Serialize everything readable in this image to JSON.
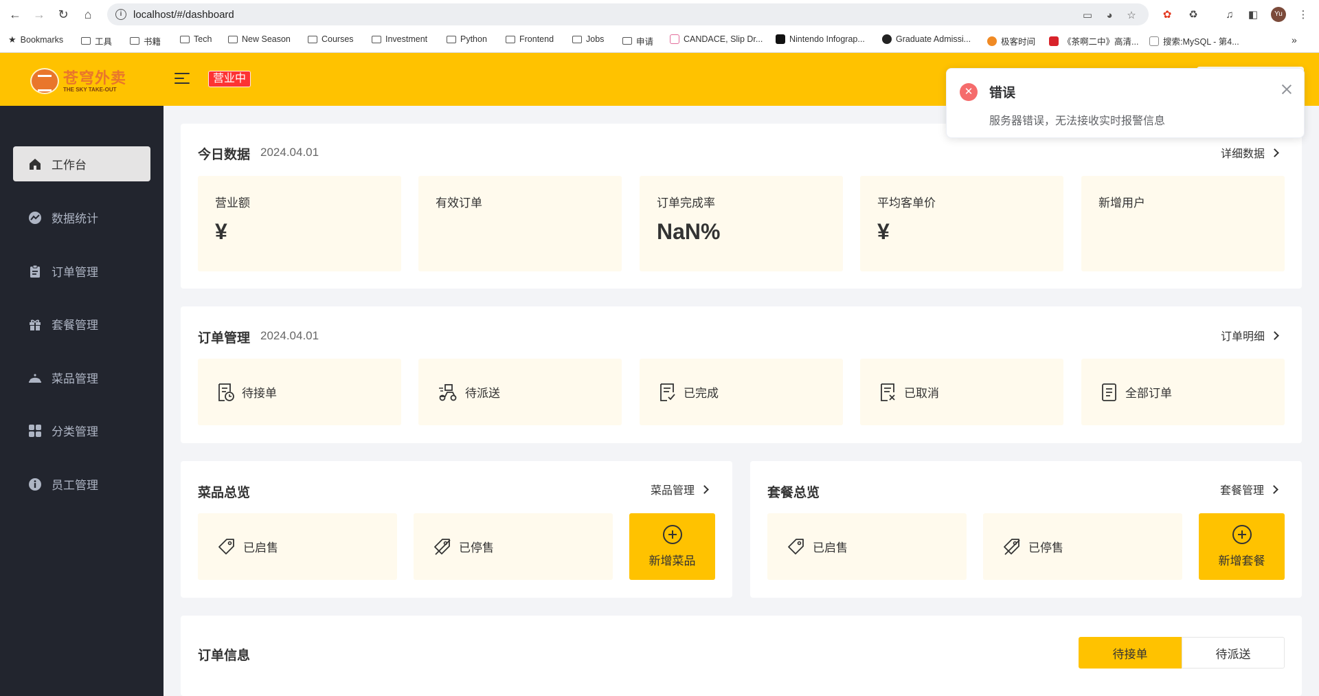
{
  "browser": {
    "url": "localhost/#/dashboard",
    "avatar": "Yu",
    "bookmarks": [
      {
        "label": "Bookmarks",
        "type": "star"
      },
      {
        "label": "工具",
        "type": "folder"
      },
      {
        "label": "书籍",
        "type": "folder"
      },
      {
        "label": "Tech",
        "type": "folder"
      },
      {
        "label": "New Season",
        "type": "folder"
      },
      {
        "label": "Courses",
        "type": "folder"
      },
      {
        "label": "Investment",
        "type": "folder"
      },
      {
        "label": "Python",
        "type": "folder"
      },
      {
        "label": "Frontend",
        "type": "folder"
      },
      {
        "label": "Jobs",
        "type": "folder"
      },
      {
        "label": "申请",
        "type": "folder"
      },
      {
        "label": "CANDACE, Slip Dr...",
        "type": "site"
      },
      {
        "label": "Nintendo Infograp...",
        "type": "site"
      },
      {
        "label": "Graduate Admissi...",
        "type": "site"
      },
      {
        "label": "极客时间",
        "type": "site"
      },
      {
        "label": "《茶啊二中》高清...",
        "type": "site"
      },
      {
        "label": "搜索:MySQL - 第4...",
        "type": "site"
      }
    ]
  },
  "header": {
    "logo_cn": "苍穹外卖",
    "logo_en": "THE SKY TAKE-OUT",
    "status": "营业中",
    "brand_color": "#ffc200"
  },
  "sidebar": {
    "items": [
      {
        "label": "工作台",
        "icon": "home-icon",
        "active": true
      },
      {
        "label": "数据统计",
        "icon": "chart-icon",
        "active": false
      },
      {
        "label": "订单管理",
        "icon": "clipboard-icon",
        "active": false
      },
      {
        "label": "套餐管理",
        "icon": "gift-icon",
        "active": false
      },
      {
        "label": "菜品管理",
        "icon": "dish-cover-icon",
        "active": false
      },
      {
        "label": "分类管理",
        "icon": "grid-icon",
        "active": false
      },
      {
        "label": "员工管理",
        "icon": "info-icon",
        "active": false
      }
    ]
  },
  "today": {
    "title": "今日数据",
    "date": "2024.04.01",
    "link": "详细数据",
    "stats": [
      {
        "label": "营业额",
        "value": "¥"
      },
      {
        "label": "有效订单",
        "value": ""
      },
      {
        "label": "订单完成率",
        "value": "NaN%"
      },
      {
        "label": "平均客单价",
        "value": "¥"
      },
      {
        "label": "新增用户",
        "value": ""
      }
    ]
  },
  "orders": {
    "title": "订单管理",
    "date": "2024.04.01",
    "link": "订单明细",
    "items": [
      {
        "label": "待接单",
        "icon": "pending-order-icon"
      },
      {
        "label": "待派送",
        "icon": "delivery-icon"
      },
      {
        "label": "已完成",
        "icon": "completed-order-icon"
      },
      {
        "label": "已取消",
        "icon": "cancelled-order-icon"
      },
      {
        "label": "全部订单",
        "icon": "all-orders-icon"
      }
    ]
  },
  "dishes": {
    "title": "菜品总览",
    "link": "菜品管理",
    "on_sale": "已启售",
    "off_sale": "已停售",
    "add": "新增菜品"
  },
  "setmeals": {
    "title": "套餐总览",
    "link": "套餐管理",
    "on_sale": "已启售",
    "off_sale": "已停售",
    "add": "新增套餐"
  },
  "order_info": {
    "title": "订单信息",
    "tabs": [
      {
        "label": "待接单",
        "active": true
      },
      {
        "label": "待派送",
        "active": false
      }
    ]
  },
  "toast": {
    "type": "error",
    "title": "错误",
    "message": "服务器错误，无法接收实时报警信息",
    "color": "#f56c6c"
  }
}
